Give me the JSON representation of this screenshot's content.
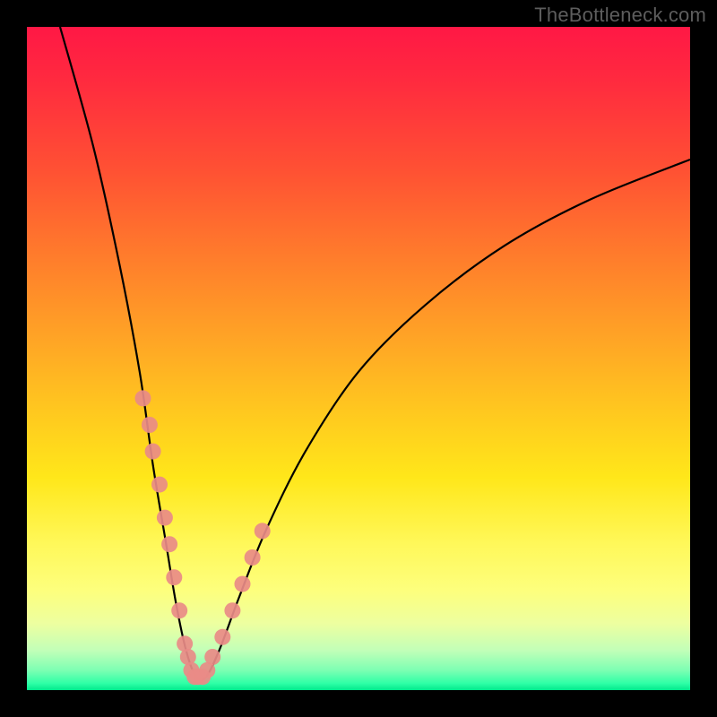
{
  "watermark": {
    "text": "TheBottleneck.com"
  },
  "chart_data": {
    "type": "line",
    "title": "",
    "xlabel": "",
    "ylabel": "",
    "xlim": [
      0,
      100
    ],
    "ylim": [
      0,
      100
    ],
    "series": [
      {
        "name": "bottleneck-curve",
        "x": [
          5,
          10,
          14,
          17,
          19,
          21,
          22.5,
          24,
          25.5,
          27,
          29,
          32,
          36,
          42,
          50,
          60,
          72,
          85,
          100
        ],
        "values": [
          100,
          82,
          64,
          48,
          34,
          22,
          13,
          6,
          2,
          2,
          6,
          14,
          24,
          36,
          48,
          58,
          67,
          74,
          80
        ]
      }
    ],
    "markers": [
      {
        "name": "left-cluster",
        "x": [
          17.5,
          18.5,
          19,
          20,
          20.8,
          21.5,
          22.2,
          23,
          23.8,
          24.3,
          24.8,
          25.3,
          25.8
        ],
        "y": [
          44,
          40,
          36,
          31,
          26,
          22,
          17,
          12,
          7,
          5,
          3,
          2,
          2
        ]
      },
      {
        "name": "right-cluster",
        "x": [
          26.5,
          27.2,
          28,
          29.5,
          31,
          32.5,
          34,
          35.5
        ],
        "y": [
          2,
          3,
          5,
          8,
          12,
          16,
          20,
          24
        ]
      }
    ],
    "colors": {
      "curve": "#000000",
      "marker_fill": "#e98b87",
      "gradient_top": "#ff1845",
      "gradient_bottom": "#00e88c"
    }
  }
}
